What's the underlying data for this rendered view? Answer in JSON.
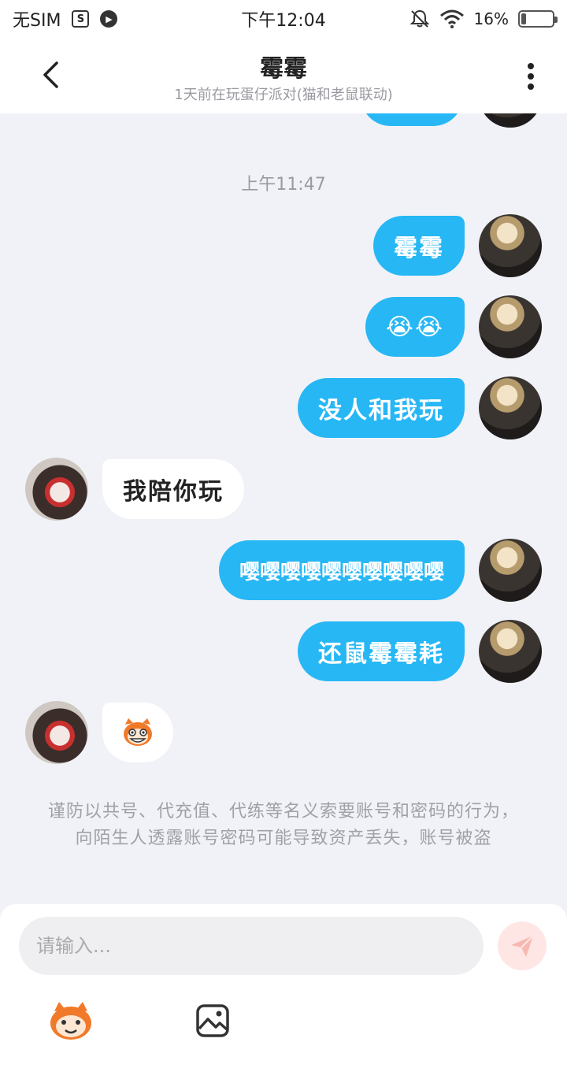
{
  "status_bar": {
    "sim": "无SIM",
    "time": "下午12:04",
    "battery": "16%",
    "battery_level": 0.16
  },
  "header": {
    "title": "霉霉",
    "subtitle": "1天前在玩蛋仔派对(猫和老鼠联动)"
  },
  "chat": {
    "timestamp": "上午11:47",
    "messages": [
      {
        "dir": "out",
        "text": "霉霉"
      },
      {
        "dir": "out",
        "text": "😭😭"
      },
      {
        "dir": "out",
        "text": "没人和我玩"
      },
      {
        "dir": "in",
        "text": "我陪你玩"
      },
      {
        "dir": "out",
        "text": "嘤嘤嘤嘤嘤嘤嘤嘤嘤嘤"
      },
      {
        "dir": "out",
        "text": "还鼠霉霉耗"
      },
      {
        "dir": "in",
        "text": "",
        "sticker": "cat-face-sticker"
      }
    ],
    "notice": "谨防以共号、代充值、代练等名义索要账号和密码的行为，向陌生人透露账号密码可能导致资产丢失，账号被盗"
  },
  "input": {
    "placeholder": "请输入..."
  },
  "colors": {
    "outgoing_bubble": "#27b7f5",
    "incoming_bubble": "#ffffff",
    "background": "#f1f2f7"
  }
}
